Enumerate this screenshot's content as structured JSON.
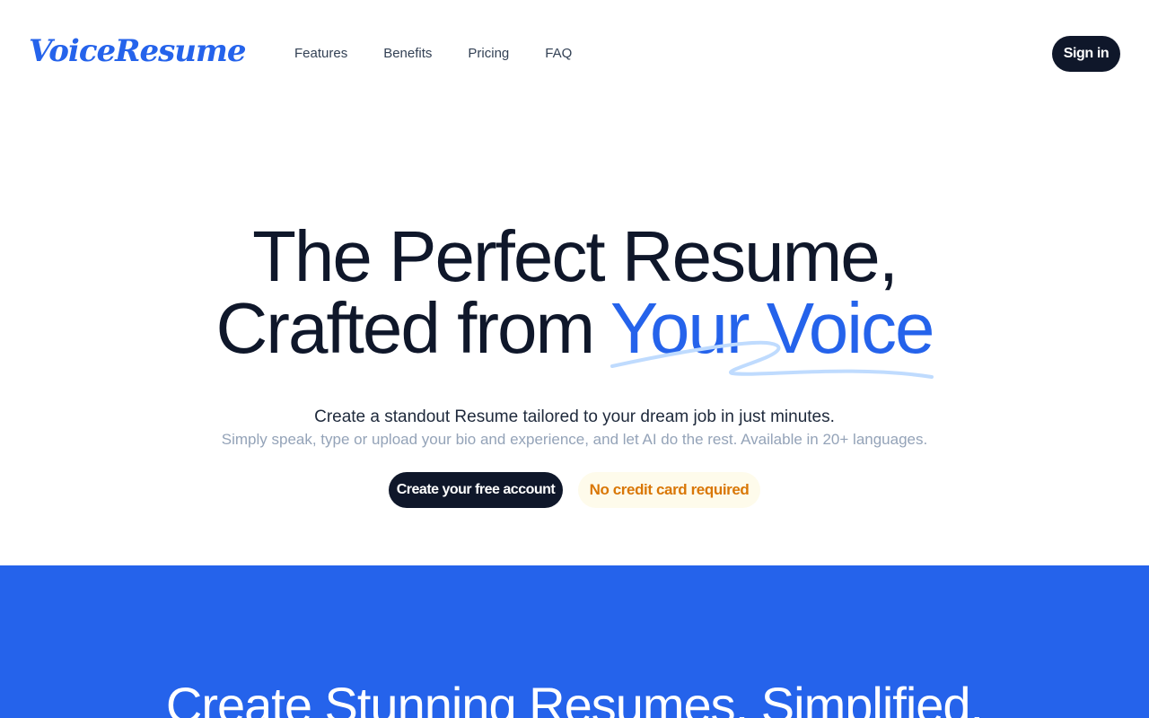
{
  "brand": {
    "logo_text": "VoiceResume",
    "accent_color": "#2563eb"
  },
  "nav": {
    "items": [
      {
        "label": "Features"
      },
      {
        "label": "Benefits"
      },
      {
        "label": "Pricing"
      },
      {
        "label": "FAQ"
      }
    ],
    "sign_in_label": "Sign in"
  },
  "hero": {
    "title_line1": "The Perfect Resume,",
    "title_line2_prefix": "Crafted from ",
    "title_highlight": "Your Voice",
    "subtitle": "Create a standout Resume tailored to your dream job in just minutes.",
    "description": "Simply speak, type or upload your bio and experience, and let AI do the rest. Available in 20+ languages.",
    "cta_label": "Create your free account",
    "badge_label": "No credit card required",
    "badge_color": "#d97706"
  },
  "section": {
    "title": "Create Stunning Resumes, Simplified.",
    "background_color": "#2563eb"
  }
}
